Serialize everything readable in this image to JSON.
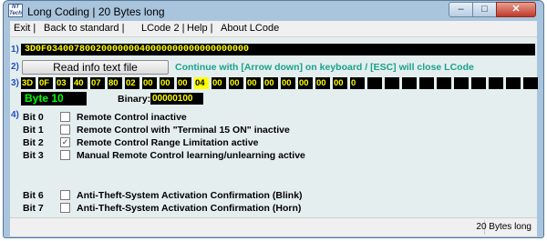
{
  "window": {
    "title": "Long Coding    | 20 Bytes long",
    "app_icon": "VCDS-logo",
    "minimize_icon": "minimize-icon",
    "maximize_icon": "maximize-icon",
    "close_icon": "close-icon"
  },
  "menu": [
    "Exit |",
    "Back to standard |",
    "LCode 2 |",
    "Help |",
    "About LCode"
  ],
  "section_numbers": [
    "1)",
    "2)",
    "3)",
    "4)"
  ],
  "coding_string": "3D0F0340078002000000040000000000000000000",
  "read_button": "Read info text file",
  "hint": "Continue with [Arrow down] on keyboard / [ESC] will close LCode",
  "bytes": [
    "3D",
    "0F",
    "03",
    "40",
    "07",
    "80",
    "02",
    "00",
    "00",
    "00",
    "04",
    "00",
    "00",
    "00",
    "00",
    "00",
    "00",
    "00",
    "00",
    "0",
    "",
    "",
    "",
    "",
    "",
    "",
    "",
    "",
    "",
    ""
  ],
  "selected_byte_index": 10,
  "byte_label": "Byte 10",
  "binary_label": "Binary:",
  "binary_value": "00000100",
  "bits": [
    {
      "bit": "Bit 0",
      "label": "Remote Control inactive",
      "checked": false
    },
    {
      "bit": "Bit 1",
      "label": "Remote Control with \"Terminal 15 ON\" inactive",
      "checked": false
    },
    {
      "bit": "Bit 2",
      "label": "Remote Control Range Limitation active",
      "checked": true
    },
    {
      "bit": "Bit 3",
      "label": "Manual Remote Control learning/unlearning active",
      "checked": false
    },
    {
      "bit": "Bit 6",
      "label": "Anti-Theft-System Activation Confirmation (Blink)",
      "checked": false
    },
    {
      "bit": "Bit 7",
      "label": "Anti-Theft-System Activation Confirmation (Horn)",
      "checked": false
    }
  ],
  "status_text": "20 Bytes long"
}
